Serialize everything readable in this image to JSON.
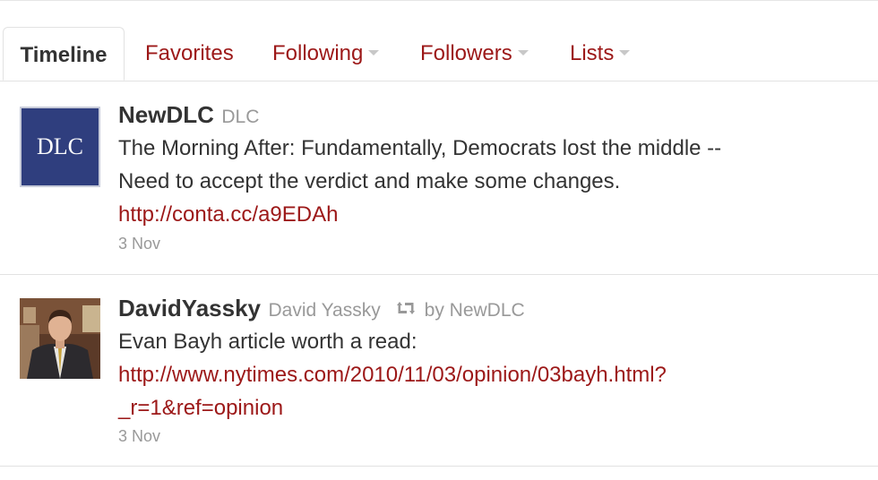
{
  "tabs": [
    {
      "label": "Timeline",
      "active": true,
      "dropdown": false
    },
    {
      "label": "Favorites",
      "active": false,
      "dropdown": false
    },
    {
      "label": "Following",
      "active": false,
      "dropdown": true
    },
    {
      "label": "Followers",
      "active": false,
      "dropdown": true
    },
    {
      "label": "Lists",
      "active": false,
      "dropdown": true
    }
  ],
  "tweets": [
    {
      "avatar": {
        "text": "DLC",
        "icon": "dlc-logo"
      },
      "screen_name": "NewDLC",
      "full_name": "DLC",
      "text_lines": [
        "The Morning After: Fundamentally, Democrats lost the middle --",
        "Need to accept the verdict and make some changes."
      ],
      "link": "http://conta.cc/a9EDAh",
      "timestamp": "3 Nov"
    },
    {
      "avatar": {
        "icon": "user-photo"
      },
      "screen_name": "DavidYassky",
      "full_name": "David Yassky",
      "retweet_icon": "retweet-icon",
      "retweeted_by": "by NewDLC",
      "text_lines": [
        "Evan Bayh article worth a read:"
      ],
      "link_lines": [
        "http://www.nytimes.com/2010/11/03/opinion/03bayh.html?",
        "_r=1&ref=opinion"
      ],
      "timestamp": "3 Nov"
    }
  ],
  "colors": {
    "link": "#9c1818",
    "text": "#333333",
    "muted": "#999999",
    "border": "#e2e2e2",
    "dlc_blue": "#2f3e7e"
  }
}
